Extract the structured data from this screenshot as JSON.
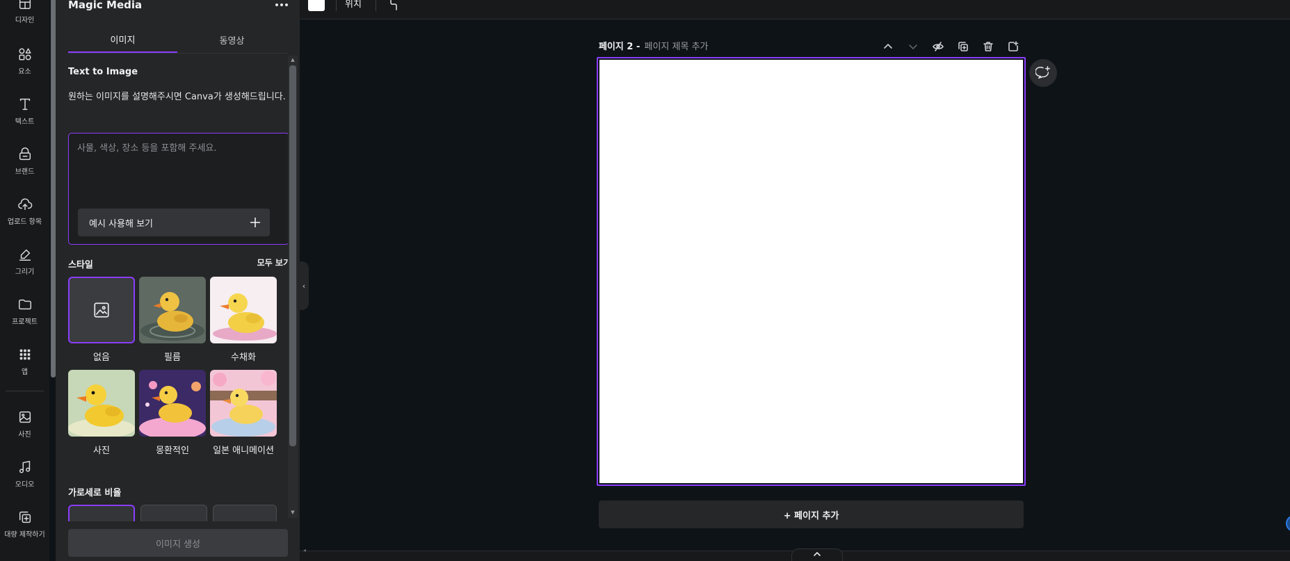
{
  "rail": {
    "items": [
      {
        "label": "디자인",
        "icon": "layout-icon"
      },
      {
        "label": "요소",
        "icon": "shapes-icon"
      },
      {
        "label": "텍스트",
        "icon": "text-icon"
      },
      {
        "label": "브랜드",
        "icon": "brand-icon"
      },
      {
        "label": "업로드 항목",
        "icon": "upload-cloud-icon"
      },
      {
        "label": "그리기",
        "icon": "draw-icon"
      },
      {
        "label": "프로젝트",
        "icon": "folder-icon"
      },
      {
        "label": "앱",
        "icon": "apps-grid-icon"
      },
      {
        "label": "사진",
        "icon": "photo-icon"
      },
      {
        "label": "오디오",
        "icon": "music-note-icon"
      },
      {
        "label": "대량 제작하기",
        "icon": "bulk-create-icon"
      }
    ]
  },
  "panel": {
    "title": "Magic Media",
    "tabs": [
      {
        "label": "이미지",
        "active": true
      },
      {
        "label": "동영상",
        "active": false
      }
    ],
    "section_title": "Text to Image",
    "description": "원하는 이미지를 설명해주시면 Canva가 생성해드립니다.",
    "prompt": {
      "value": "",
      "placeholder": "사물, 색상, 장소 등을 포함해 주세요."
    },
    "example_button": "예시 사용해 보기",
    "styles_heading": "스타일",
    "see_all": "모두 보기",
    "styles": [
      {
        "label": "없음",
        "selected": true
      },
      {
        "label": "필름",
        "selected": false
      },
      {
        "label": "수채화",
        "selected": false
      },
      {
        "label": "사진",
        "selected": false
      },
      {
        "label": "몽환적인",
        "selected": false
      },
      {
        "label": "일본 애니메이션",
        "selected": false
      }
    ],
    "ratio_heading": "가로세로 비율",
    "generate_button": "이미지 생성"
  },
  "toolbar": {
    "position_label": "위치"
  },
  "canvas": {
    "page_number": "페이지 2 -",
    "page_title_placeholder": "페이지 제목 추가",
    "add_page": "+ 페이지 추가"
  },
  "colors": {
    "accent": "#8b3dff",
    "background": "#0e1318",
    "panel": "#252627",
    "rail": "#18191b"
  }
}
